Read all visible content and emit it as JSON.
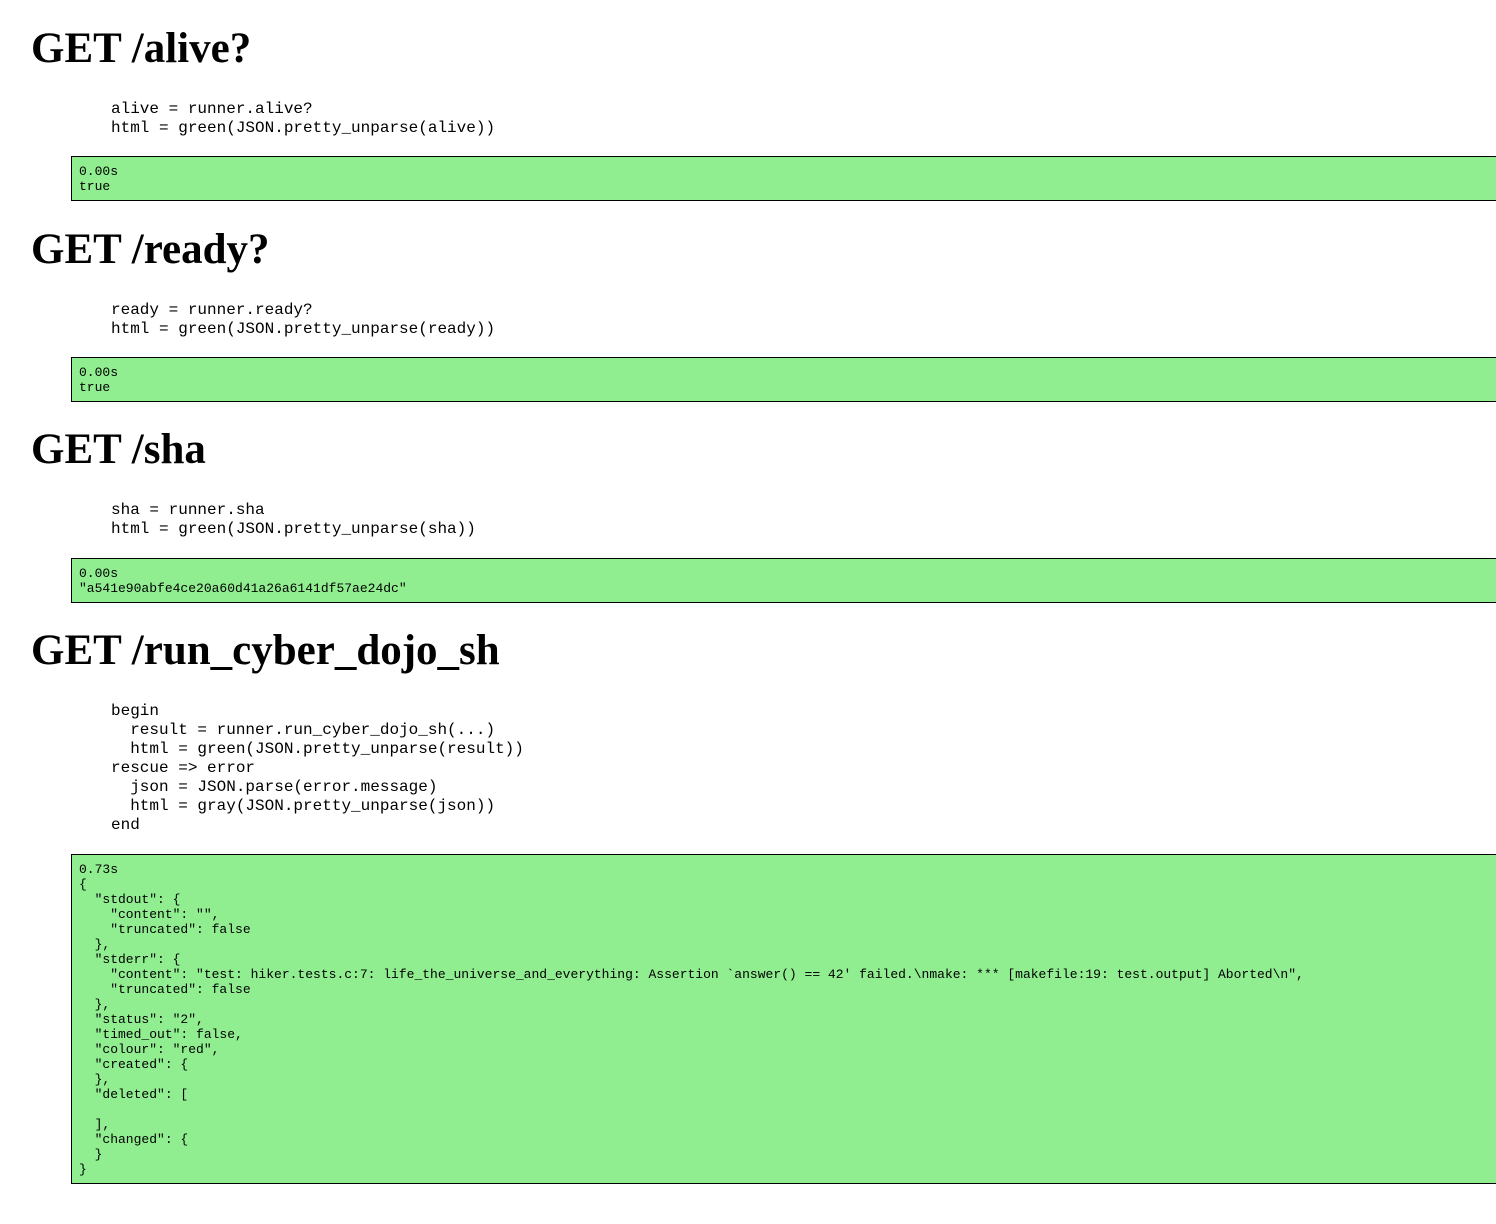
{
  "sections": [
    {
      "heading": "GET /alive?",
      "code": "alive = runner.alive?\nhtml = green(JSON.pretty_unparse(alive))",
      "result": {
        "timing": "0.00s",
        "body": "true"
      }
    },
    {
      "heading": "GET /ready?",
      "code": "ready = runner.ready?\nhtml = green(JSON.pretty_unparse(ready))",
      "result": {
        "timing": "0.00s",
        "body": "true"
      }
    },
    {
      "heading": "GET /sha",
      "code": "sha = runner.sha\nhtml = green(JSON.pretty_unparse(sha))",
      "result": {
        "timing": "0.00s",
        "body": "\"a541e90abfe4ce20a60d41a26a6141df57ae24dc\""
      }
    },
    {
      "heading": "GET /run_cyber_dojo_sh",
      "code": "begin\n  result = runner.run_cyber_dojo_sh(...)\n  html = green(JSON.pretty_unparse(result))\nrescue => error\n  json = JSON.parse(error.message)\n  html = gray(JSON.pretty_unparse(json))\nend",
      "result": {
        "timing": "0.73s",
        "body": "{\n  \"stdout\": {\n    \"content\": \"\",\n    \"truncated\": false\n  },\n  \"stderr\": {\n    \"content\": \"test: hiker.tests.c:7: life_the_universe_and_everything: Assertion `answer() == 42' failed.\\nmake: *** [makefile:19: test.output] Aborted\\n\",\n    \"truncated\": false\n  },\n  \"status\": \"2\",\n  \"timed_out\": false,\n  \"colour\": \"red\",\n  \"created\": {\n  },\n  \"deleted\": [\n\n  ],\n  \"changed\": {\n  }\n}"
      }
    }
  ],
  "colors": {
    "result_background": "#90ee90",
    "result_border": "#000000"
  }
}
